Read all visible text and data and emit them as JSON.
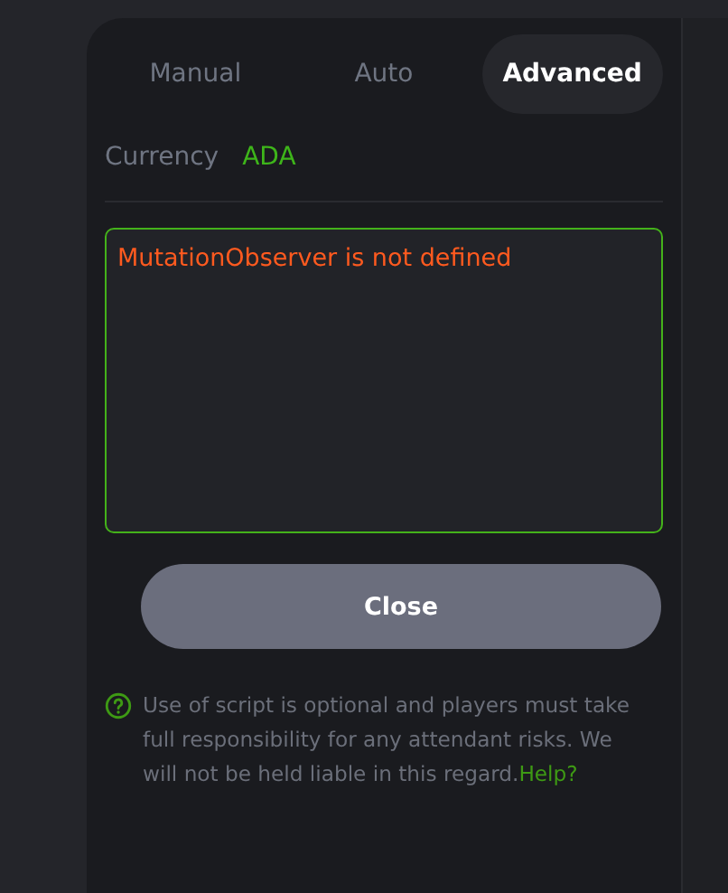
{
  "tabs": [
    {
      "label": "Manual",
      "selected": false
    },
    {
      "label": "Auto",
      "selected": false
    },
    {
      "label": "Advanced",
      "selected": true
    }
  ],
  "currency": {
    "label": "Currency",
    "value": "ADA"
  },
  "script_box": {
    "value": "MutationObserver is not defined"
  },
  "close_button": "Close",
  "notice": {
    "text": "Use of script is optional and players must take full responsibility for any attendant risks. We will not be held liable in this regard.",
    "link": "Help?"
  }
}
